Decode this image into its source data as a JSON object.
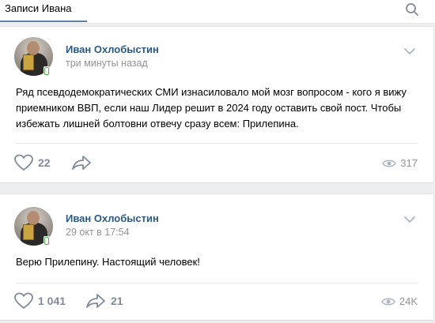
{
  "header": {
    "title": "Записи Ивана"
  },
  "posts": [
    {
      "author": "Иван Охлобыстин",
      "time": "три минуты назад",
      "text": "Ряд псевдодемократических СМИ изнасиловало мой мозг вопросом - кого я вижу приемником ВВП, если наш Лидер решит в 2024 году оставить свой пост. Чтобы избежать лишней болтовни отвечу сразу всем: Прилепина.",
      "likes": "22",
      "shares": "",
      "views": "317"
    },
    {
      "author": "Иван Охлобыстин",
      "time": "29 окт в 17:54",
      "text": "Верю Прилепину. Настоящий человек!",
      "likes": "1 041",
      "shares": "21",
      "views": "24K"
    }
  ],
  "colors": {
    "background": "#edeef0",
    "author_link": "#2a5885",
    "meta_gray": "#939393",
    "action_gray": "#828a99",
    "online_mobile": "#4bb34b"
  },
  "icons": [
    "search-icon",
    "chevron-down-icon",
    "heart-icon",
    "share-arrow-icon",
    "eye-icon",
    "mobile-online-icon"
  ]
}
